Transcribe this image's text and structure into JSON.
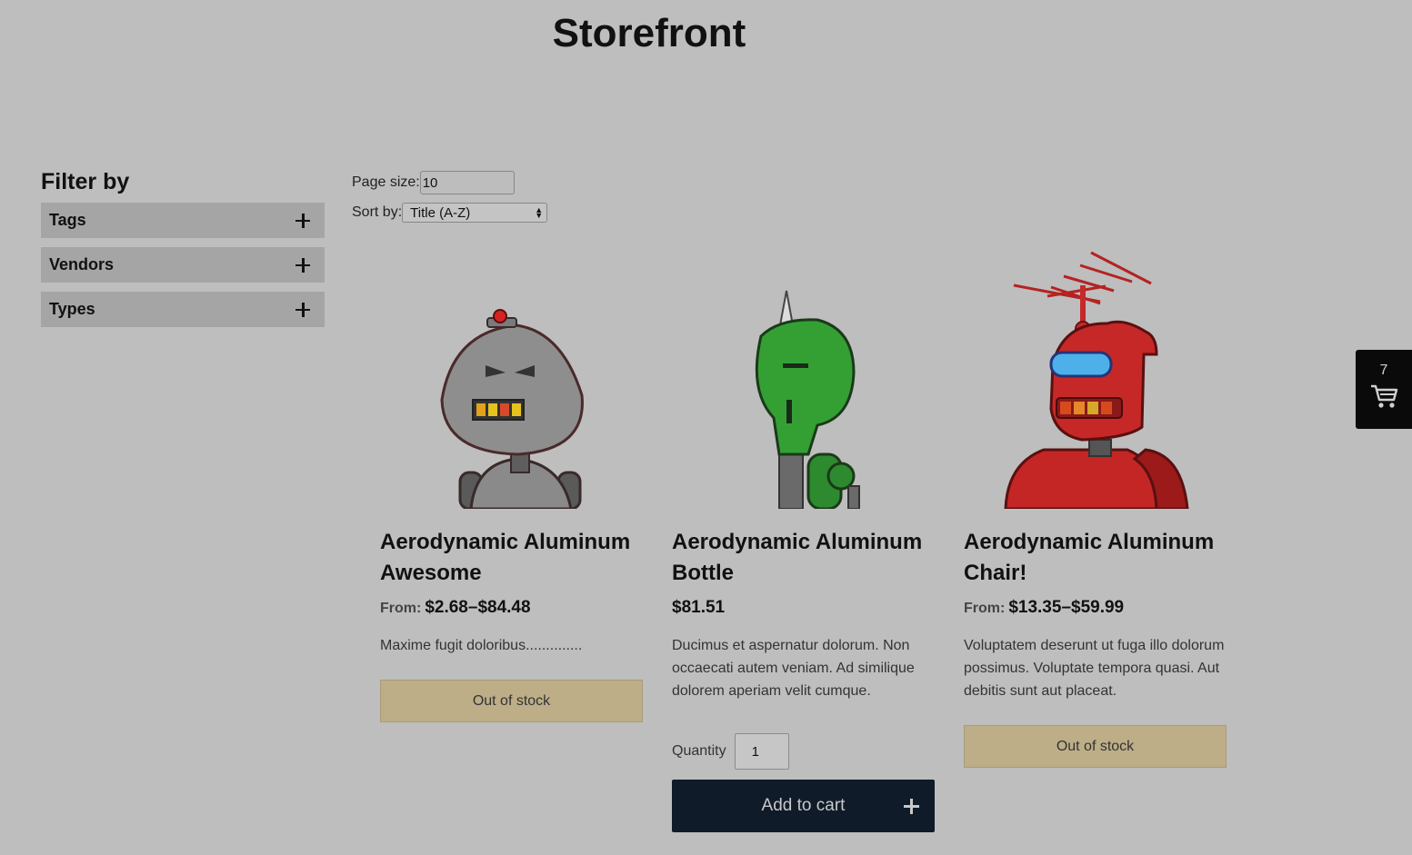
{
  "header": {
    "title": "Storefront"
  },
  "filters": {
    "heading": "Filter by",
    "groups": [
      {
        "label": "Tags",
        "icon": "plus-icon"
      },
      {
        "label": "Vendors",
        "icon": "plus-icon"
      },
      {
        "label": "Types",
        "icon": "plus-icon"
      }
    ]
  },
  "controls": {
    "page_size_label": "Page size:",
    "page_size_value": "10",
    "sort_label": "Sort by:",
    "sort_value": "Title (A-Z)"
  },
  "products": [
    {
      "title": "Aerodynamic Aluminum Awesome",
      "price_prefix": "From:",
      "price": "$2.68–$84.48",
      "description": "Maxime fugit doloribus..............",
      "stock_label": "Out of stock",
      "image": "gray-robot"
    },
    {
      "title": "Aerodynamic Aluminum Bottle",
      "price_prefix": "",
      "price": "$81.51",
      "description": "Ducimus et aspernatur dolorum. Non occaecati autem veniam. Ad similique dolorem aperiam velit cumque.",
      "quantity_label": "Quantity",
      "quantity_value": "1",
      "add_to_cart_label": "Add to cart",
      "image": "green-robot"
    },
    {
      "title": "Aerodynamic Aluminum Chair!",
      "price_prefix": "From:",
      "price": "$13.35–$59.99",
      "description": "Voluptatem deserunt ut fuga illo dolorum possimus. Voluptate tempora quasi. Aut debitis sunt aut placeat.",
      "stock_label": "Out of stock",
      "image": "red-robot"
    }
  ],
  "cart": {
    "count": "7",
    "icon": "cart-icon"
  },
  "colors": {
    "background": "#bebebe",
    "filter_bg": "#a5a5a5",
    "out_of_stock_bg": "#bdae88",
    "add_to_cart_bg": "#0f1b29",
    "cart_widget_bg": "#0a0a0a"
  }
}
